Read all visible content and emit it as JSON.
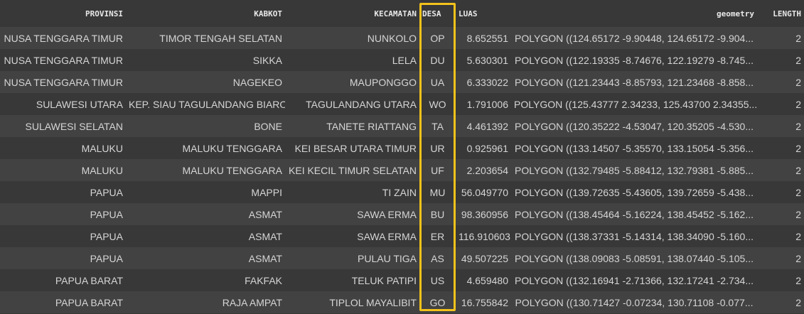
{
  "columns": [
    "PROVINSI",
    "KABKOT",
    "KECAMATAN",
    "DESA",
    "LUAS",
    "geometry",
    "LENGTH"
  ],
  "highlight_color": "#f2c21b",
  "rows": [
    [
      "NUSA TENGGARA TIMUR",
      "TIMOR TENGAH SELATAN",
      "NUNKOLO",
      "OP",
      "8.652551",
      "POLYGON ((124.65172 -9.90448, 124.65172 -9.904...",
      "2"
    ],
    [
      "NUSA TENGGARA TIMUR",
      "SIKKA",
      "LELA",
      "DU",
      "5.630301",
      "POLYGON ((122.19335 -8.74676, 122.19279 -8.745...",
      "2"
    ],
    [
      "NUSA TENGGARA TIMUR",
      "NAGEKEO",
      "MAUPONGGO",
      "UA",
      "6.333022",
      "POLYGON ((121.23443 -8.85793, 121.23468 -8.858...",
      "2"
    ],
    [
      "SULAWESI UTARA",
      "KEP. SIAU TAGULANDANG BIARO",
      "TAGULANDANG UTARA",
      "WO",
      "1.791006",
      "POLYGON ((125.43777 2.34233, 125.43700 2.34355...",
      "2"
    ],
    [
      "SULAWESI SELATAN",
      "BONE",
      "TANETE RIATTANG",
      "TA",
      "4.461392",
      "POLYGON ((120.35222 -4.53047, 120.35205 -4.530...",
      "2"
    ],
    [
      "MALUKU",
      "MALUKU TENGGARA",
      "KEI BESAR UTARA TIMUR",
      "UR",
      "0.925961",
      "POLYGON ((133.14507 -5.35570, 133.15054 -5.356...",
      "2"
    ],
    [
      "MALUKU",
      "MALUKU TENGGARA",
      "KEI KECIL TIMUR SELATAN",
      "UF",
      "2.203654",
      "POLYGON ((132.79485 -5.88412, 132.79381 -5.885...",
      "2"
    ],
    [
      "PAPUA",
      "MAPPI",
      "TI ZAIN",
      "MU",
      "56.049770",
      "POLYGON ((139.72635 -5.43605, 139.72659 -5.438...",
      "2"
    ],
    [
      "PAPUA",
      "ASMAT",
      "SAWA ERMA",
      "BU",
      "98.360956",
      "POLYGON ((138.45464 -5.16224, 138.45452 -5.162...",
      "2"
    ],
    [
      "PAPUA",
      "ASMAT",
      "SAWA ERMA",
      "ER",
      "116.910603",
      "POLYGON ((138.37331 -5.14314, 138.34090 -5.160...",
      "2"
    ],
    [
      "PAPUA",
      "ASMAT",
      "PULAU TIGA",
      "AS",
      "49.507225",
      "POLYGON ((138.09083 -5.08591, 138.07440 -5.105...",
      "2"
    ],
    [
      "PAPUA BARAT",
      "FAKFAK",
      "TELUK PATIPI",
      "US",
      "4.659480",
      "POLYGON ((132.16941 -2.71366, 132.17241 -2.734...",
      "2"
    ],
    [
      "PAPUA BARAT",
      "RAJA AMPAT",
      "TIPLOL MAYALIBIT",
      "GO",
      "16.755842",
      "POLYGON ((130.71427 -0.07234, 130.71108 -0.077...",
      "2"
    ]
  ]
}
